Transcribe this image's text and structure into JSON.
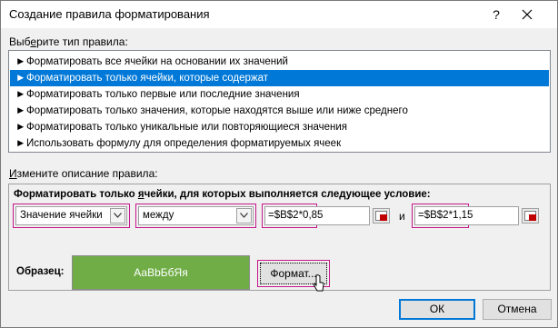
{
  "dialog": {
    "title": "Создание правила форматирования",
    "help_glyph": "?",
    "close_glyph": "✕"
  },
  "rule_type": {
    "label_prefix": "Выб",
    "label_underlined": "е",
    "label_suffix": "рите тип правила:",
    "items": [
      {
        "label": "Форматировать все ячейки на основании их значений"
      },
      {
        "label": "Форматировать только ячейки, которые содержат"
      },
      {
        "label": "Форматировать только первые или последние значения"
      },
      {
        "label": "Форматировать только значения, которые находятся выше или ниже среднего"
      },
      {
        "label": "Форматировать только уникальные или повторяющиеся значения"
      },
      {
        "label": "Использовать формулу для определения форматируемых ячеек"
      }
    ],
    "selected_index": 1
  },
  "description": {
    "label_prefix": "",
    "label_underlined": "И",
    "label_suffix": "змените описание правила:",
    "condition_prefix": "Форматировать только ",
    "condition_underlined": "я",
    "condition_suffix": "чейки, для которых выполняется следующее условие:",
    "cell_type_value": "Значение ячейки",
    "operator_value": "между",
    "value1": "=$B$2*0,85",
    "and_label": "и",
    "value2": "=$B$2*1,15",
    "sample_label": "Образец:",
    "sample_text": "АаВbБбЯя",
    "format_button_label": "Формат..."
  },
  "buttons": {
    "ok": "ОК",
    "cancel": "Отмена"
  },
  "colors": {
    "selection": "#0078d7",
    "highlight": "#c5168a",
    "sample_fill": "#70ad47"
  }
}
